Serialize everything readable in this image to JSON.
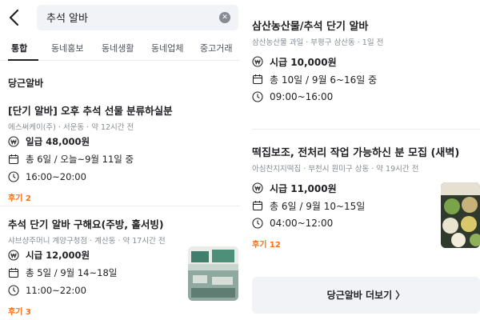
{
  "search": {
    "query": "추석 알바"
  },
  "tabs": [
    {
      "label": "통합"
    },
    {
      "label": "동네홍보"
    },
    {
      "label": "동네생활"
    },
    {
      "label": "동네업체"
    },
    {
      "label": "중고거래"
    }
  ],
  "section": {
    "title": "당근알바"
  },
  "jobs": [
    {
      "title": "[단기 알바] 오후 추석 선물 분류하실분",
      "meta": "에스써케이(주) · 서운동 · 약 12시간 전",
      "pay": "일급 48,000원",
      "schedule": "총 6일 / 오늘~9월 11일 중",
      "hours": "16:00~20:00",
      "review": "후기 2"
    },
    {
      "title": "추석 단기 알바 구해요(주방, 홀서빙)",
      "meta": "샤브샹주머니 계양구청점 · 계산동 · 약 17시간 전",
      "pay": "시급 12,000원",
      "schedule": "총 5일 / 9월 14~18일",
      "hours": "11:00~22:00",
      "review": "후기 3"
    },
    {
      "title": "삼산농산물/추석 단기 알바",
      "meta": "삼산농산물 과일 · 부평구 삼산동 · 1일 전",
      "pay": "시급 10,000원",
      "schedule": "총 10일 / 9월 6~16일 중",
      "hours": "09:00~16:00"
    },
    {
      "title": "떡집보조, 전처리 작업 가능하신 분 모집 (새벽)",
      "meta": "아심찬지지떡집 · 부천시 원미구 상동 · 약 19시간 전",
      "pay": "시급 11,000원",
      "schedule": "총 6일 / 9월 10~15일",
      "hours": "04:00~12:00",
      "review": "후기 12"
    }
  ],
  "more_button": {
    "label": "당근알바 더보기 〉"
  },
  "colors": {
    "accent": "#ff6f0f",
    "text": "#212124",
    "meta": "#868b94",
    "chip": "#f2f3f6"
  },
  "icons": [
    "back-arrow-icon",
    "clear-icon",
    "won-icon",
    "calendar-icon",
    "clock-icon"
  ]
}
